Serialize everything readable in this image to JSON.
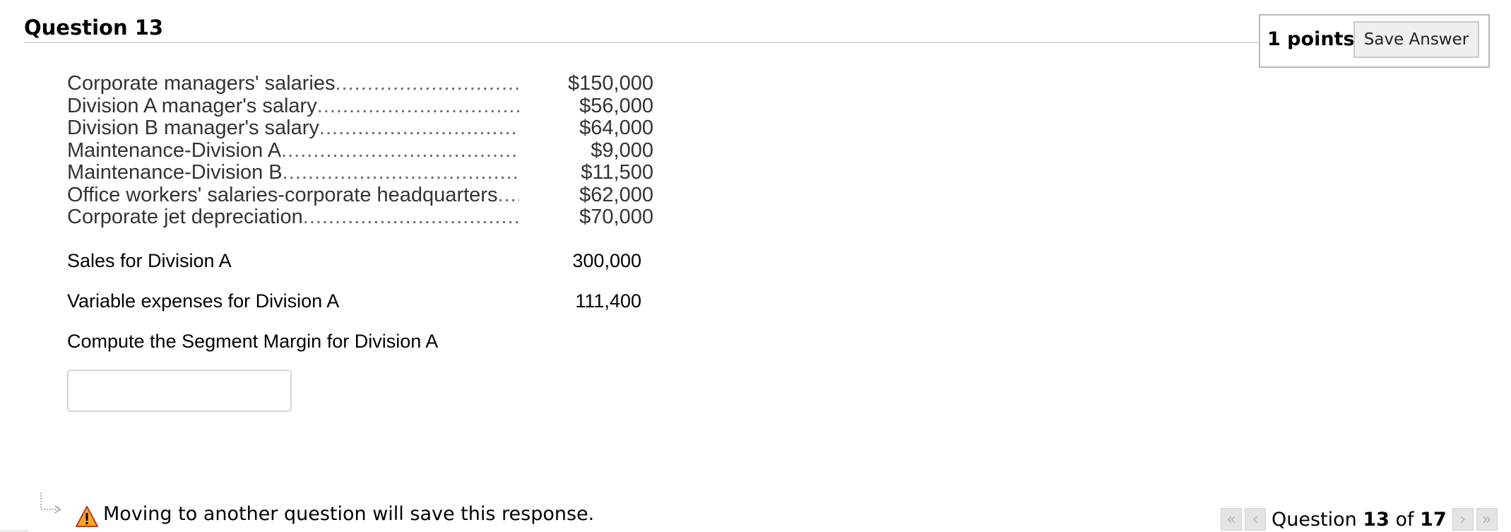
{
  "header": {
    "title": "Question 13",
    "points_label": "1 points",
    "save_button_label": "Save Answer"
  },
  "expenses": [
    {
      "label": "Corporate managers' salaries",
      "amount": "$150,000"
    },
    {
      "label": "Division A manager's salary",
      "amount": "$56,000"
    },
    {
      "label": "Division B manager's salary",
      "amount": "$64,000"
    },
    {
      "label": "Maintenance-Division A",
      "amount": "$9,000"
    },
    {
      "label": "Maintenance-Division B",
      "amount": "$11,500"
    },
    {
      "label": "Office workers' salaries-corporate headquarters",
      "amount": "$62,000"
    },
    {
      "label": "Corporate jet depreciation",
      "amount": "$70,000"
    }
  ],
  "info": {
    "sales_label": "Sales for Division A",
    "sales_value": "300,000",
    "variable_label": "Variable expenses for Division A",
    "variable_value": "111,400",
    "prompt": "Compute the Segment Margin for Division A"
  },
  "answer": {
    "value": ""
  },
  "footer": {
    "warning_text": "Moving to another question will save this response.",
    "pager_prefix": "Question",
    "pager_current": "13",
    "pager_of": "of",
    "pager_total": "17"
  },
  "colors": {
    "warning_fill": "#f5a623",
    "pager_disabled": "#e4e4e4"
  },
  "icons": {
    "warning": "warning-triangle-icon",
    "first": "double-chevron-left-icon",
    "prev": "chevron-left-icon",
    "next": "chevron-right-icon",
    "last": "double-chevron-right-icon",
    "arrow": "return-arrow-icon"
  }
}
